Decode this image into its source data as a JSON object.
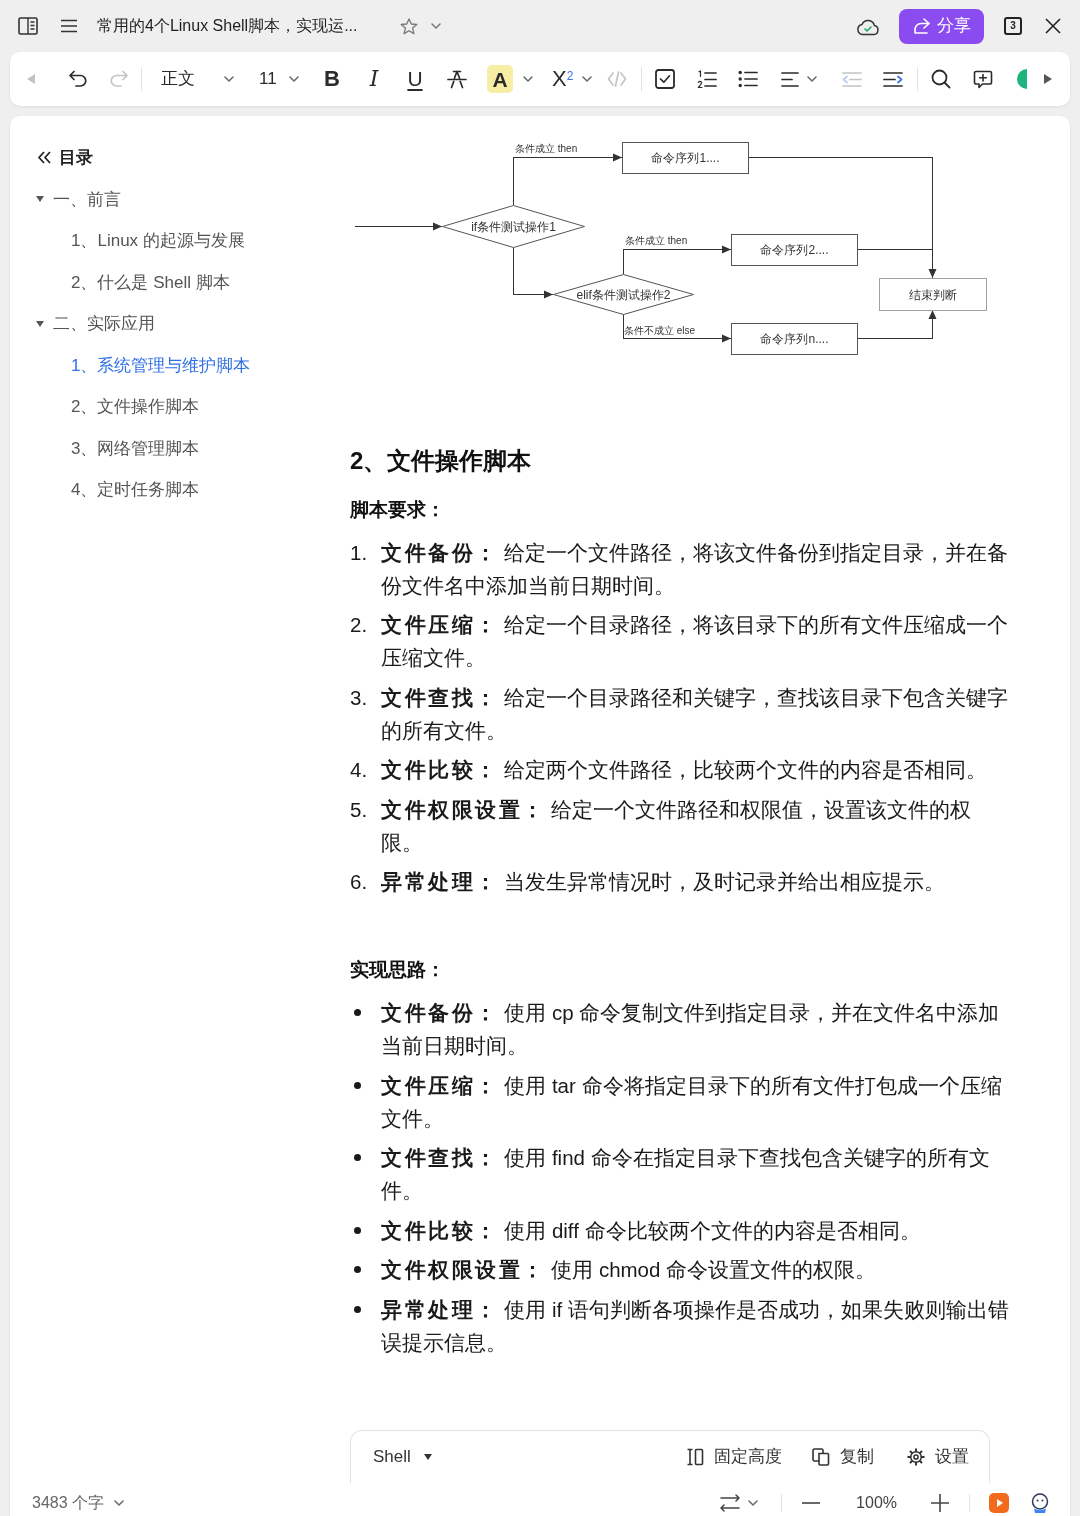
{
  "title_bar": {
    "title": "常用的4个Linux Shell脚本，实现运...",
    "starred": false,
    "share_button": "分享",
    "tab_count": "3"
  },
  "toolbar": {
    "groups": [
      [
        {
          "kind": "back",
          "disabled": true
        },
        {
          "kind": "undo",
          "disabled": false
        },
        {
          "kind": "redo",
          "disabled": true
        }
      ],
      [
        {
          "kind": "paragraph_style",
          "label": "正文",
          "disabled": false
        },
        {
          "kind": "font_size",
          "label": "11",
          "disabled": false
        },
        {
          "kind": "bold",
          "label": "B",
          "disabled": false
        },
        {
          "kind": "italic",
          "label": "I",
          "disabled": false
        },
        {
          "kind": "underline",
          "label": "U",
          "disabled": false
        },
        {
          "kind": "strikethrough",
          "disabled": false
        },
        {
          "kind": "text_color",
          "label": "A",
          "disabled": false
        },
        {
          "kind": "superscript",
          "label": "X$^{2}$",
          "disabled": false
        },
        {
          "kind": "code",
          "disabled": true
        }
      ],
      [
        {
          "kind": "checklist",
          "disabled": false
        },
        {
          "kind": "ordered_list",
          "disabled": false
        },
        {
          "kind": "bullet_list",
          "disabled": false
        },
        {
          "kind": "align",
          "disabled": false
        },
        {
          "kind": "outdent",
          "disabled": true
        },
        {
          "kind": "indent",
          "disabled": false
        }
      ],
      [
        {
          "kind": "search",
          "disabled": false
        },
        {
          "kind": "comment",
          "disabled": false
        },
        {
          "kind": "collaborator",
          "disabled": false
        },
        {
          "kind": "more",
          "disabled": false
        }
      ]
    ]
  },
  "toc": {
    "title": "目录",
    "items": [
      {
        "label": "一、前言",
        "expanded": true,
        "selected": false,
        "children": [
          {
            "label": "1、Linux 的起源与发展",
            "selected": false
          },
          {
            "label": "2、什么是 Shell 脚本",
            "selected": false
          }
        ]
      },
      {
        "label": "二、实际应用",
        "expanded": true,
        "selected": false,
        "children": [
          {
            "label": "1、系统管理与维护脚本",
            "selected": true
          },
          {
            "label": "2、文件操作脚本",
            "selected": false
          },
          {
            "label": "3、网络管理脚本",
            "selected": false
          },
          {
            "label": "4、定时任务脚本",
            "selected": false
          }
        ]
      }
    ]
  },
  "document": {
    "flowchart": {
      "nodes": [
        {
          "kind": "decision",
          "label": "if条件测试操作1"
        },
        {
          "kind": "process",
          "label": "命令序列1...."
        },
        {
          "kind": "decision",
          "label": "elif条件测试操作2"
        },
        {
          "kind": "process",
          "label": "命令序列2...."
        },
        {
          "kind": "process",
          "label": "命令序列n...."
        },
        {
          "kind": "terminal",
          "label": "结束判断"
        }
      ],
      "edge_labels": [
        "条件成立 then",
        "条件成立 then",
        "条件不成立 else"
      ]
    },
    "heading": "2、文件操作脚本",
    "sections": [
      {
        "kind": "ordered",
        "title": "脚本要求：",
        "items": [
          {
            "number": "1.",
            "text": "**文件备份：** 给定一个文件路径，将该文件备份到指定目录，并在备份文件名中添加当前日期时间。"
          },
          {
            "number": "2.",
            "text": "**文件压缩：** 给定一个目录路径，将该目录下的所有文件压缩成一个压缩文件。"
          },
          {
            "number": "3.",
            "text": "**文件查找：** 给定一个目录路径和关键字，查找该目录下包含关键字的所有文件。"
          },
          {
            "number": "4.",
            "text": "**文件比较：** 给定两个文件路径，比较两个文件的内容是否相同。"
          },
          {
            "number": "5.",
            "text": "**文件权限设置：** 给定一个文件路径和权限值，设置该文件的权限。"
          },
          {
            "number": "6.",
            "text": "**异常处理：** 当发生异常情况时，及时记录并给出相应提示。"
          }
        ]
      },
      {
        "kind": "bullet",
        "title": "实现思路：",
        "items": [
          {
            "text": "**文件备份：** 使用 cp 命令复制文件到指定目录，并在文件名中添加当前日期时间。"
          },
          {
            "text": "**文件压缩：** 使用 tar 命令将指定目录下的所有文件打包成一个压缩文件。"
          },
          {
            "text": "**文件查找：** 使用 find 命令在指定目录下查找包含关键字的所有文件。"
          },
          {
            "text": "**文件比较：** 使用 diff 命令比较两个文件的内容是否相同。"
          },
          {
            "text": "**文件权限设置：** 使用 chmod 命令设置文件的权限。"
          },
          {
            "text": "**异常处理：** 使用 if 语句判断各项操作是否成功，如果失败则输出错误提示信息。"
          }
        ]
      }
    ],
    "code_block": {
      "language": "Shell",
      "actions": [
        {
          "kind": "fixed_height",
          "label": "固定高度"
        },
        {
          "kind": "copy",
          "label": "复制"
        },
        {
          "kind": "settings",
          "label": "设置"
        }
      ]
    }
  },
  "status_bar": {
    "word_count": "3483 个字",
    "zoom": "100%"
  }
}
